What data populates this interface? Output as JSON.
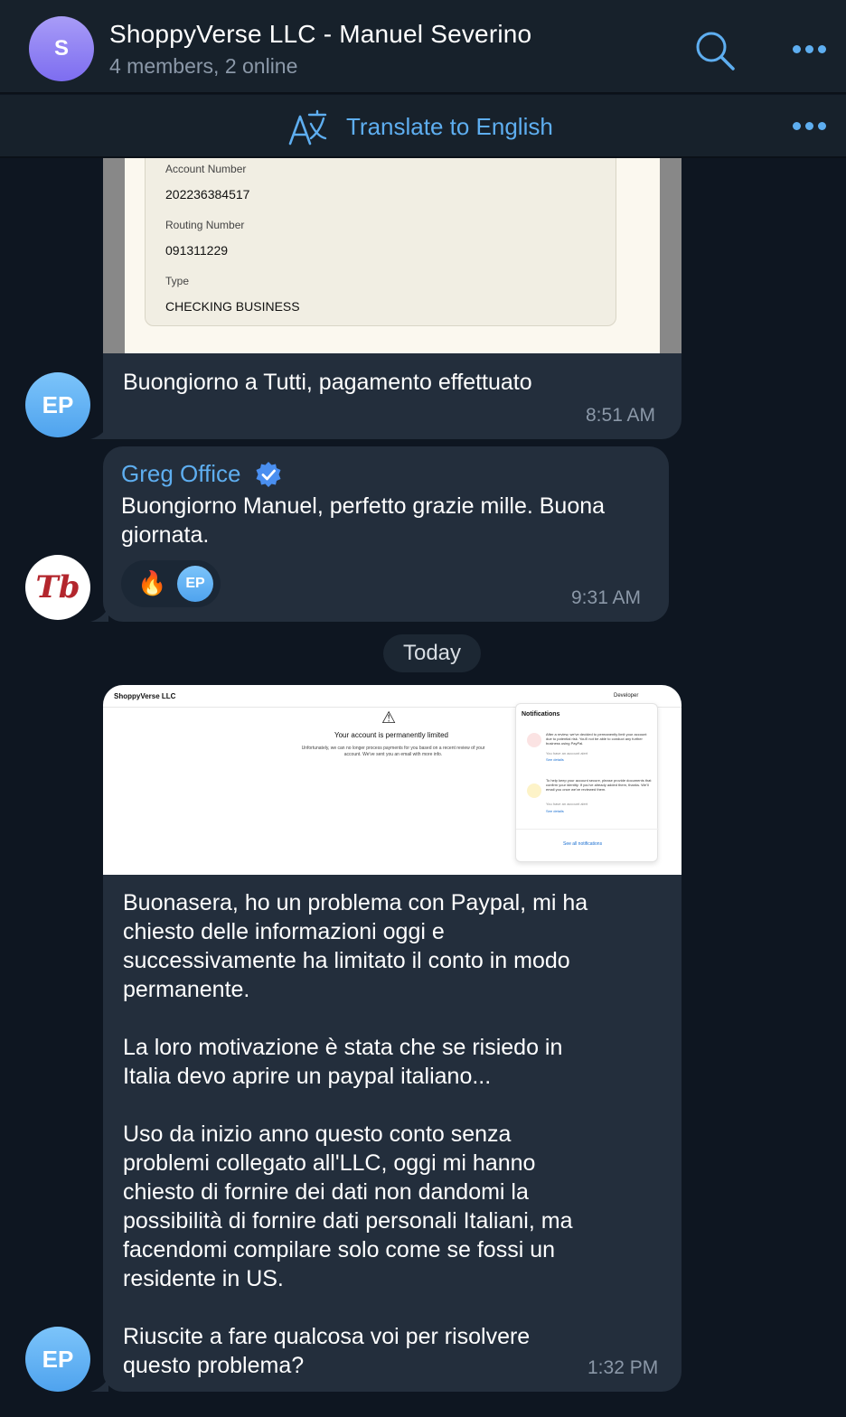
{
  "header": {
    "avatar_letter": "S",
    "title": "ShoppyVerse LLC - Manuel Severino",
    "subtitle": "4 members, 2 online"
  },
  "translate": {
    "label": "Translate to English"
  },
  "messages": [
    {
      "sender_initials": "EP",
      "document": {
        "account_number_label": "Account Number",
        "account_number": "202236384517",
        "routing_number_label": "Routing Number",
        "routing_number": "091311229",
        "type_label": "Type",
        "type": "CHECKING BUSINESS"
      },
      "text": "Buongiorno a Tutti, pagamento effettuato",
      "time": "8:51 AM"
    },
    {
      "sender_name": "Greg Office",
      "sender_logo_text": "Tb",
      "text_line1": "Buongiorno Manuel, perfetto grazie mille. Buona",
      "text_line2": "giornata.",
      "reaction_emoji": "🔥",
      "reaction_user": "EP",
      "time": "9:31 AM"
    },
    {
      "sender_initials": "EP",
      "screenshot": {
        "brand": "ShoppyVerse LLC",
        "developer": "Developer",
        "headline": "Your account is permanently limited",
        "body": "Unfortunately, we can no longer process payments for you based on a recent review of your account. We've sent you an email with more info.",
        "notifications_title": "Notifications",
        "notif1": "After a review, we've decided to permanently limit your account due to potential risk. You'll not be able to conduct any further business using PayPal.",
        "notif1_sub": "You have an account alert",
        "notif1_link": "See details",
        "notif2": "To help keep your account secure, please provide documents that confirm your identity. If you've already added them, thanks. We'll email you once we've reviewed them.",
        "notif2_sub": "You have an account alert",
        "notif2_link": "See details",
        "see_all": "See all notifications"
      },
      "paragraphs": [
        [
          "Buonasera, ho un problema con Paypal, mi ha",
          "chiesto delle informazioni oggi e",
          "successivamente ha limitato il conto in modo",
          "permanente."
        ],
        [
          "La loro motivazione è stata che se risiedo in",
          "Italia devo aprire un paypal italiano..."
        ],
        [
          "Uso da inizio anno questo conto senza",
          "problemi collegato all'LLC, oggi mi hanno",
          "chiesto di fornire dei dati non dandomi la",
          "possibilità di fornire dati personali Italiani, ma",
          "facendomi compilare solo come se fossi un",
          "residente in US."
        ],
        [
          "Riuscite a fare qualcosa voi per risolvere",
          "questo problema?"
        ]
      ],
      "time": "1:32 PM"
    }
  ],
  "date_separator": "Today",
  "colors": {
    "background": "#0e1621",
    "panel": "#17212b",
    "bubble": "#232e3c",
    "accent": "#5eaef0",
    "muted": "#8b98a8"
  }
}
